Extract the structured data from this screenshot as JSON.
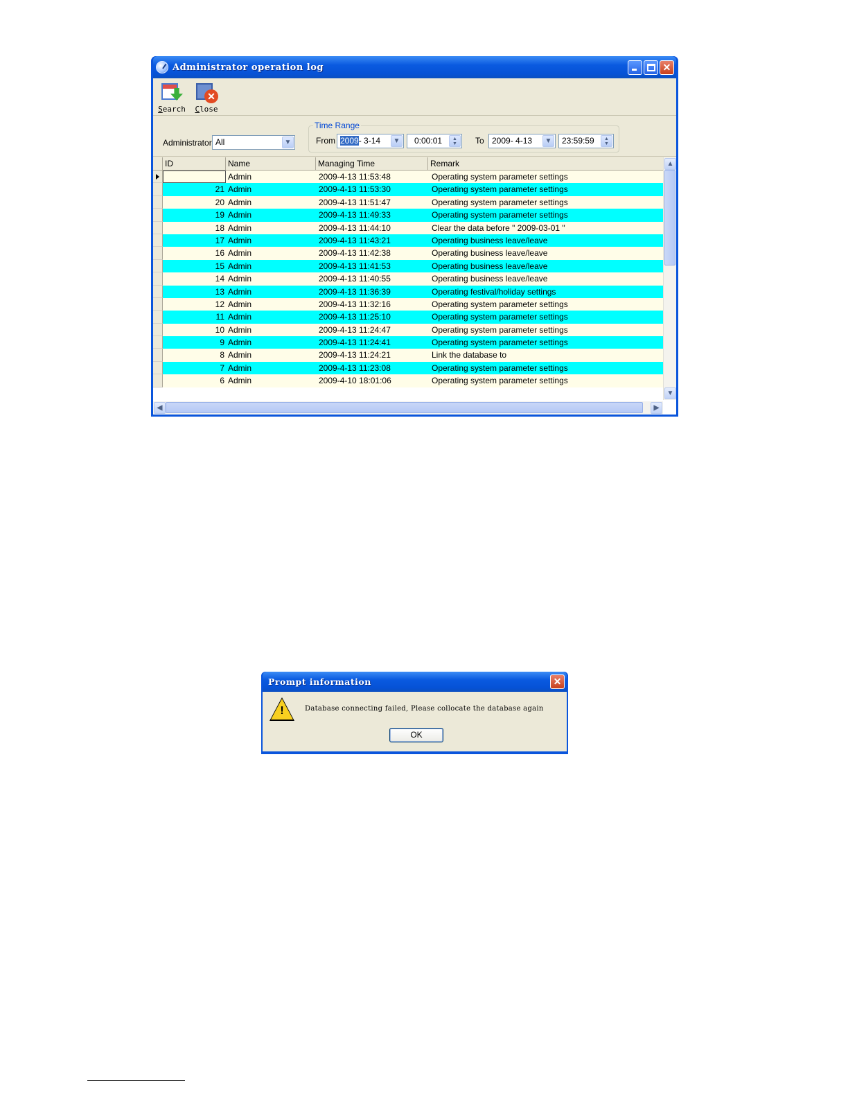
{
  "main_window": {
    "title": "Administrator operation log",
    "toolbar": {
      "search": {
        "key": "S",
        "rest": "earch"
      },
      "close": {
        "key": "C",
        "rest": "lose"
      }
    },
    "filters": {
      "administrator_label": "Administrator",
      "administrator_value": "All",
      "time_range_label": "Time Range",
      "from_label": "From",
      "from_date_year": "2009",
      "from_date_rest": "-  3-14",
      "from_time": "0:00:01",
      "to_label": "To",
      "to_date": "2009-  4-13",
      "to_time": "23:59:59"
    },
    "grid": {
      "columns": [
        "ID",
        "Name",
        "Managing Time",
        "Remark"
      ],
      "rows": [
        {
          "id": "",
          "name": "Admin",
          "time": "2009-4-13 11:53:48",
          "remark": "Operating system parameter settings"
        },
        {
          "id": "21",
          "name": "Admin",
          "time": "2009-4-13 11:53:30",
          "remark": "Operating system parameter settings"
        },
        {
          "id": "20",
          "name": "Admin",
          "time": "2009-4-13 11:51:47",
          "remark": "Operating system parameter settings"
        },
        {
          "id": "19",
          "name": "Admin",
          "time": "2009-4-13 11:49:33",
          "remark": "Operating system parameter settings"
        },
        {
          "id": "18",
          "name": "Admin",
          "time": "2009-4-13 11:44:10",
          "remark": "Clear the data before \" 2009-03-01 \""
        },
        {
          "id": "17",
          "name": "Admin",
          "time": "2009-4-13 11:43:21",
          "remark": "Operating business leave/leave"
        },
        {
          "id": "16",
          "name": "Admin",
          "time": "2009-4-13 11:42:38",
          "remark": "Operating business leave/leave"
        },
        {
          "id": "15",
          "name": "Admin",
          "time": "2009-4-13 11:41:53",
          "remark": "Operating business leave/leave"
        },
        {
          "id": "14",
          "name": "Admin",
          "time": "2009-4-13 11:40:55",
          "remark": "Operating business leave/leave"
        },
        {
          "id": "13",
          "name": "Admin",
          "time": "2009-4-13 11:36:39",
          "remark": "Operating festival/holiday settings"
        },
        {
          "id": "12",
          "name": "Admin",
          "time": "2009-4-13 11:32:16",
          "remark": "Operating system parameter settings"
        },
        {
          "id": "11",
          "name": "Admin",
          "time": "2009-4-13 11:25:10",
          "remark": "Operating system parameter settings"
        },
        {
          "id": "10",
          "name": "Admin",
          "time": "2009-4-13 11:24:47",
          "remark": "Operating system parameter settings"
        },
        {
          "id": "9",
          "name": "Admin",
          "time": "2009-4-13 11:24:41",
          "remark": "Operating system parameter settings"
        },
        {
          "id": "8",
          "name": "Admin",
          "time": "2009-4-13 11:24:21",
          "remark": "Link the database to"
        },
        {
          "id": "7",
          "name": "Admin",
          "time": "2009-4-13 11:23:08",
          "remark": "Operating system parameter settings"
        },
        {
          "id": "6",
          "name": "Admin",
          "time": "2009-4-10 18:01:06",
          "remark": "Operating system parameter settings"
        }
      ]
    }
  },
  "dialog": {
    "title": "Prompt information",
    "message": "Database connecting failed, Please collocate the database again",
    "ok_label": "OK"
  },
  "colors": {
    "row_alt": "#00ffff",
    "row_base": "#fffde8",
    "titlebar": "#0a55dc"
  }
}
